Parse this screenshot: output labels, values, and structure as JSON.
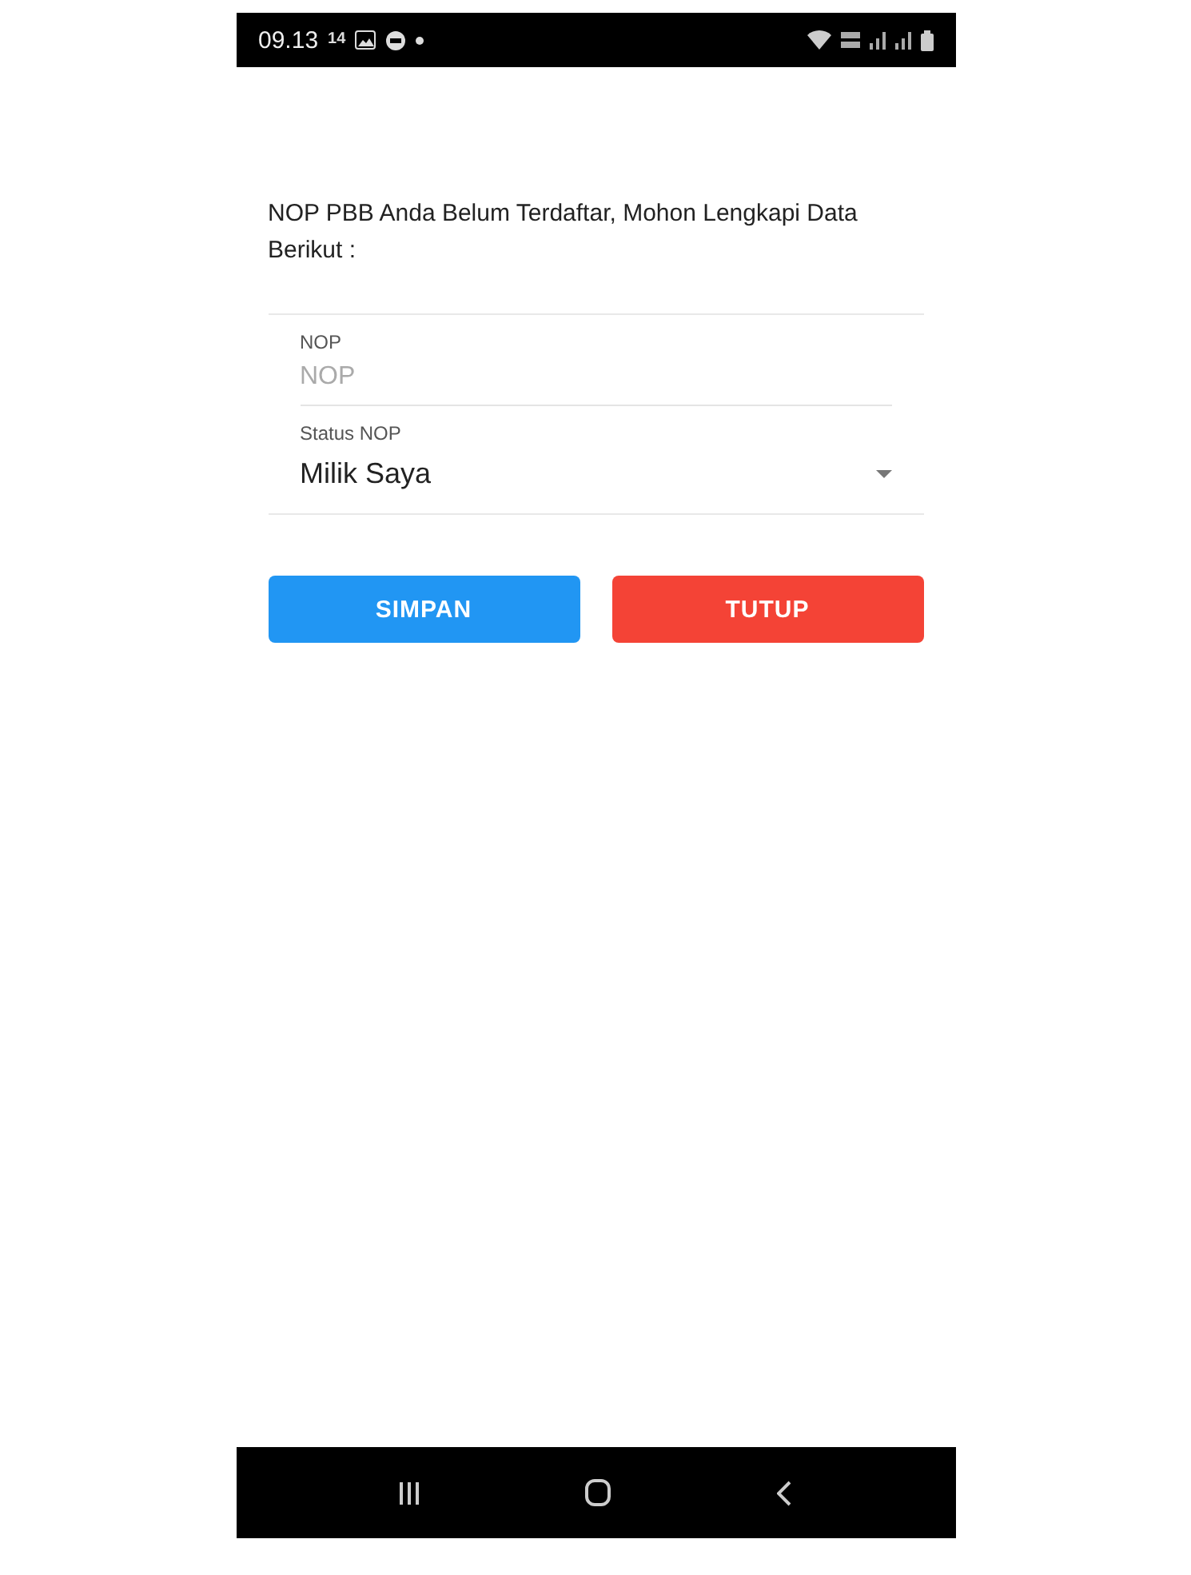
{
  "status_bar": {
    "time": "09.13",
    "net_speed": "14"
  },
  "message": "NOP PBB Anda Belum Terdaftar, Mohon Lengkapi Data Berikut :",
  "fields": [
    {
      "kind": "text",
      "label": "NOP",
      "placeholder": "NOP"
    },
    {
      "kind": "select",
      "label": "Status NOP",
      "value": "Milik Saya"
    }
  ],
  "buttons": [
    {
      "label": "SIMPAN",
      "color": "#2196f3"
    },
    {
      "label": "TUTUP",
      "color": "#f44336"
    }
  ]
}
